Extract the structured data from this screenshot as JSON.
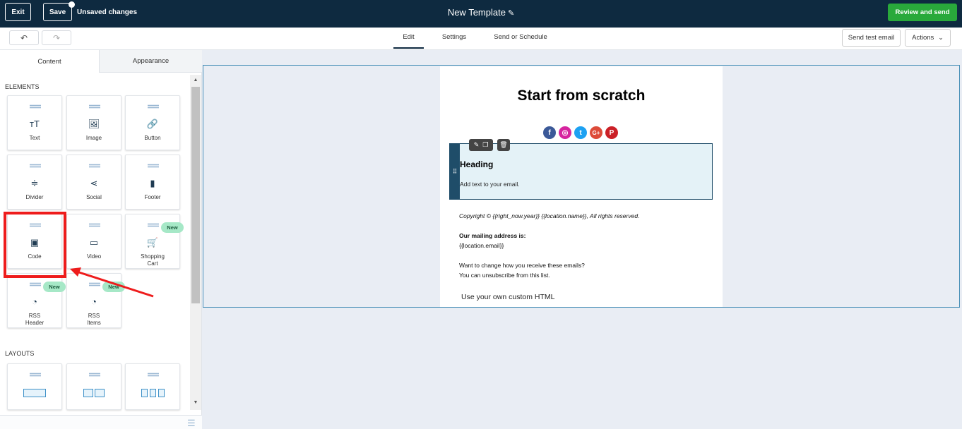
{
  "topbar": {
    "exit_label": "Exit",
    "save_label": "Save",
    "unsaved_label": "Unsaved changes",
    "title": "New Template",
    "review_label": "Review and send"
  },
  "subbar": {
    "tabs": [
      {
        "label": "Edit"
      },
      {
        "label": "Settings"
      },
      {
        "label": "Send or Schedule"
      }
    ],
    "send_test_label": "Send test email",
    "actions_label": "Actions"
  },
  "panel": {
    "tabs": [
      {
        "label": "Content"
      },
      {
        "label": "Appearance"
      }
    ],
    "elements_label": "ELEMENTS",
    "layouts_label": "LAYOUTS",
    "elements": [
      {
        "label": "Text",
        "icon": "text-icon",
        "glyph": "тТ"
      },
      {
        "label": "Image",
        "icon": "image-icon",
        "glyph": "🖼"
      },
      {
        "label": "Button",
        "icon": "link-icon",
        "glyph": "🔗"
      },
      {
        "label": "Divider",
        "icon": "divider-icon",
        "glyph": "≑"
      },
      {
        "label": "Social",
        "icon": "share-icon",
        "glyph": "⋖"
      },
      {
        "label": "Footer",
        "icon": "footer-icon",
        "glyph": "▮"
      },
      {
        "label": "Code",
        "icon": "terminal-icon",
        "glyph": "▣"
      },
      {
        "label": "Video",
        "icon": "video-icon",
        "glyph": "▭"
      },
      {
        "label": "Shopping Cart",
        "icon": "cart-icon",
        "glyph": "🛒",
        "badge": "New"
      },
      {
        "label": "RSS Header",
        "icon": "rss-icon",
        "glyph": "◔",
        "badge": "New"
      },
      {
        "label": "RSS Items",
        "icon": "rss-icon",
        "glyph": "◔",
        "badge": "New"
      }
    ]
  },
  "email": {
    "title": "Start from scratch",
    "socials": [
      {
        "icon": "facebook-icon",
        "glyph": "f",
        "color": "#3b5998"
      },
      {
        "icon": "instagram-icon",
        "glyph": "◎",
        "color": "#d6249f"
      },
      {
        "icon": "twitter-icon",
        "glyph": "t",
        "color": "#1da1f2"
      },
      {
        "icon": "google-plus-icon",
        "glyph": "G+",
        "color": "#dd4b39"
      },
      {
        "icon": "pinterest-icon",
        "glyph": "P",
        "color": "#cb2027"
      }
    ],
    "heading": "Heading",
    "body_text": "Add text to your email.",
    "copyright": "Copyright © {{right_now.year}}  {{location.name}}, All rights reserved.",
    "mailing_label": "Our mailing address is:",
    "mailing_value": "{{location.email}}",
    "change_line": "Want to change how you receive these emails?",
    "unsubscribe_line": "You can unsubscribe from this list.",
    "custom_html": "Use your own custom HTML"
  },
  "colors": {
    "topbar": "#0e2a40",
    "review_button": "#29a93b",
    "highlight": "#ee1c1c"
  }
}
